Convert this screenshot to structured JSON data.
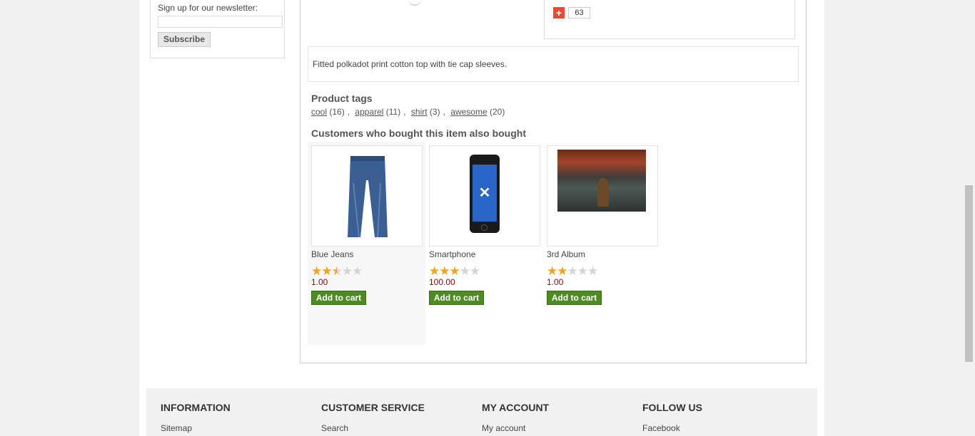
{
  "newsletter": {
    "label": "Sign up for our newsletter:",
    "input_placeholder": "",
    "subscribe_label": "Subscribe"
  },
  "share": {
    "count": "63",
    "icon": "plus-icon"
  },
  "product": {
    "description": "Fitted polkadot print cotton top with tie cap sleeves."
  },
  "tags": {
    "title": "Product tags",
    "items": [
      {
        "name": "cool",
        "count": "(16)"
      },
      {
        "name": "apparel",
        "count": "(11)"
      },
      {
        "name": "shirt",
        "count": "(3)"
      },
      {
        "name": "awesome",
        "count": "(20)"
      }
    ]
  },
  "also_bought": {
    "title": "Customers who bought this item also bought",
    "items": [
      {
        "name": "Blue Jeans",
        "rating": 2.5,
        "price": "1.00",
        "cart_label": "Add to cart",
        "image": "jeans"
      },
      {
        "name": "Smartphone",
        "rating": 3,
        "price": "100.00",
        "cart_label": "Add to cart",
        "image": "smartphone"
      },
      {
        "name": "3rd Album",
        "rating": 2,
        "price": "1.00",
        "cart_label": "Add to cart",
        "image": "album-cover"
      }
    ]
  },
  "footer": {
    "columns": [
      {
        "title": "INFORMATION",
        "link": "Sitemap"
      },
      {
        "title": "CUSTOMER SERVICE",
        "link": "Search"
      },
      {
        "title": "MY ACCOUNT",
        "link": "My account"
      },
      {
        "title": "FOLLOW US",
        "link": "Facebook"
      }
    ]
  },
  "colors": {
    "accent_green": "#4e8b22",
    "price_red": "#990000",
    "star_gold": "#f3a21b"
  }
}
